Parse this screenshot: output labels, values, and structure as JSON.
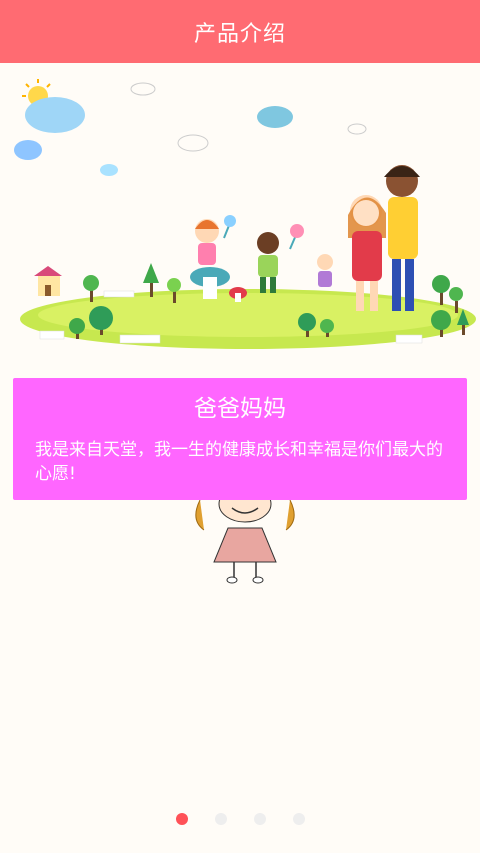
{
  "header": {
    "title": "产品介绍"
  },
  "slide": {
    "title": "爸爸妈妈",
    "text": "我是来自天堂，我一生的健康成长和幸福是你们最大的心愿!"
  },
  "pager": {
    "count": 4,
    "active_index": 0
  },
  "colors": {
    "header": "#ff6b72",
    "card": "#ff66ff",
    "dot_active": "#ff5157",
    "dot_inactive": "#eeeeee",
    "background": "#fffcf7"
  }
}
